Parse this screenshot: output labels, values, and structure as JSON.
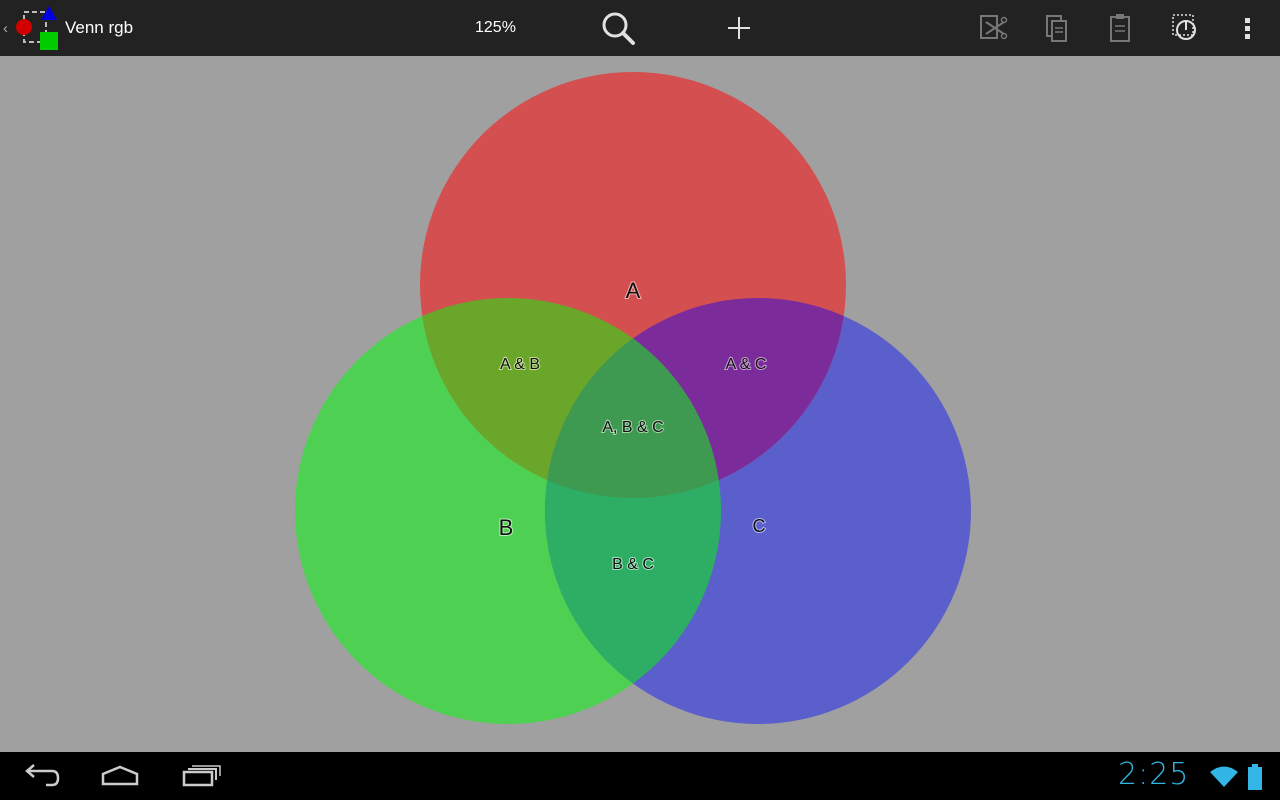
{
  "app": {
    "title": "Venn rgb",
    "zoom": "125%",
    "icon": "shapes-app-icon"
  },
  "toolbar": {
    "items": [
      {
        "name": "search-icon",
        "enabled": true
      },
      {
        "name": "add-icon",
        "enabled": true
      },
      {
        "name": "cut-icon",
        "enabled": false
      },
      {
        "name": "copy-icon",
        "enabled": false
      },
      {
        "name": "paste-icon",
        "enabled": false
      },
      {
        "name": "select-shape-icon",
        "enabled": true
      },
      {
        "name": "overflow-menu-icon",
        "enabled": true
      }
    ]
  },
  "diagram": {
    "background": "#a0a0a0",
    "circles": [
      {
        "name": "A",
        "color": "#d45050"
      },
      {
        "name": "B",
        "color": "#4ed152"
      },
      {
        "name": "C",
        "color": "#5a5fcb"
      }
    ],
    "labels": {
      "a": "A",
      "b": "B",
      "c": "C",
      "ab": "A & B",
      "ac": "A & C",
      "bc": "B & C",
      "abc": "A, B & C"
    }
  },
  "system_bar": {
    "clock": "2:25",
    "accent": "#33b5e5",
    "nav": [
      "back-icon",
      "home-icon",
      "recent-apps-icon"
    ],
    "status": [
      "wifi-icon",
      "battery-icon"
    ]
  }
}
